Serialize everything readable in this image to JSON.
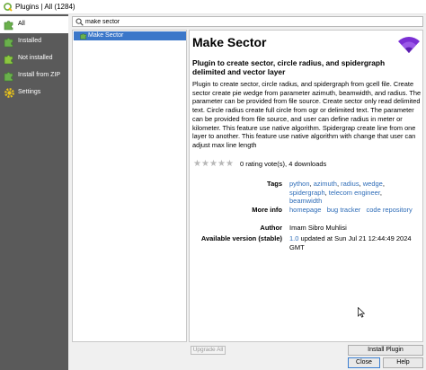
{
  "window": {
    "title": "Plugins | All (1284)"
  },
  "sidebar": {
    "items": [
      {
        "label": "All",
        "icon": "puzzle-all-icon",
        "active": true
      },
      {
        "label": "Installed",
        "icon": "puzzle-installed-icon",
        "active": false
      },
      {
        "label": "Not installed",
        "icon": "puzzle-not-installed-icon",
        "active": false
      },
      {
        "label": "Install from ZIP",
        "icon": "zip-install-icon",
        "active": false
      },
      {
        "label": "Settings",
        "icon": "gear-icon",
        "active": false
      }
    ]
  },
  "search": {
    "value": "make sector",
    "placeholder": ""
  },
  "plugin_list": {
    "items": [
      {
        "label": "Make Sector",
        "selected": true
      }
    ]
  },
  "details": {
    "title": "Make Sector",
    "subtitle": "Plugin to create sector, circle radius, and spidergraph from gcell file. Create sector create pie wedge from parameter azimuth, beamwidth, and radius. The parameter can be provided from file source. Create sector only read delimited text. Circle radius create full circle from ogr or delimited text. The parameter can be provided from file source, and user can define radius in meter or kilometer. This feature use native algorithm. Spidergrap create line from one layer to another. This feature use native algorithm with change that user can adjust max line length",
    "heading": "Plugin to create sector, circle radius, and spidergraph delimited and vector layer",
    "description": "Plugin to create sector, circle radius, and spidergraph from gcell file. Create sector create pie wedge from parameter azimuth, beamwidth, and radius. The parameter can be provided from file source. Create sector only read delimited text. Circle radius create full circle from ogr or delimited text. The parameter can be provided from file source, and user can define radius in meter or kilometer. This feature use native algorithm. Spidergrap create line from one layer to another. This feature use native algorithm with change that user can adjust max line length",
    "rating": {
      "stars": 0,
      "max": 5,
      "text": "0 rating vote(s), 4 downloads"
    },
    "tags_label": "Tags",
    "tags": [
      "python",
      "azimuth",
      "radius",
      "wedge",
      "spidergraph",
      "telecom engineer",
      "beamwidth"
    ],
    "more_info_label": "More info",
    "more_info": [
      "homepage",
      "bug tracker",
      "code repository"
    ],
    "author_label": "Author",
    "author": "Imam Sibro Muhlisi",
    "version_label": "Available version (stable)",
    "version": "1.0",
    "version_suffix": "updated at Sun Jul 21 12:44:49 2024 GMT",
    "accent_color": "#7b2fd4",
    "link_color": "#2f6db8"
  },
  "buttons": {
    "upgrade_all": "Upgrade All",
    "install": "Install Plugin",
    "close": "Close",
    "help": "Help"
  }
}
